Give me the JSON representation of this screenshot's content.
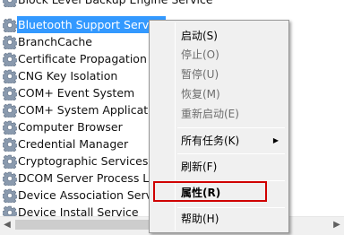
{
  "services": [
    {
      "name": "Block Level Backup Engine Service",
      "selected": false
    },
    {
      "name": "Bluetooth Support Service",
      "selected": true
    },
    {
      "name": "BranchCache",
      "selected": false
    },
    {
      "name": "Certificate Propagation",
      "selected": false
    },
    {
      "name": "CNG Key Isolation",
      "selected": false
    },
    {
      "name": "COM+ Event System",
      "selected": false
    },
    {
      "name": "COM+ System Application",
      "selected": false
    },
    {
      "name": "Computer Browser",
      "selected": false
    },
    {
      "name": "Credential Manager",
      "selected": false
    },
    {
      "name": "Cryptographic Services",
      "selected": false
    },
    {
      "name": "DCOM Server Process Launcher",
      "selected": false
    },
    {
      "name": "Device Association Service",
      "selected": false
    },
    {
      "name": "Device Install Service",
      "selected": false
    }
  ],
  "context_menu": {
    "start": "启动(S)",
    "stop": "停止(O)",
    "pause": "暂停(U)",
    "resume": "恢复(M)",
    "restart": "重新启动(E)",
    "all_tasks": "所有任务(K)",
    "refresh": "刷新(F)",
    "properties": "属性(R)",
    "help": "帮助(H)"
  },
  "scrollbar": {
    "left_arrow": "◀",
    "right_arrow": "▶"
  },
  "colors": {
    "selection": "#3399ff",
    "highlight_box": "#d00000"
  }
}
